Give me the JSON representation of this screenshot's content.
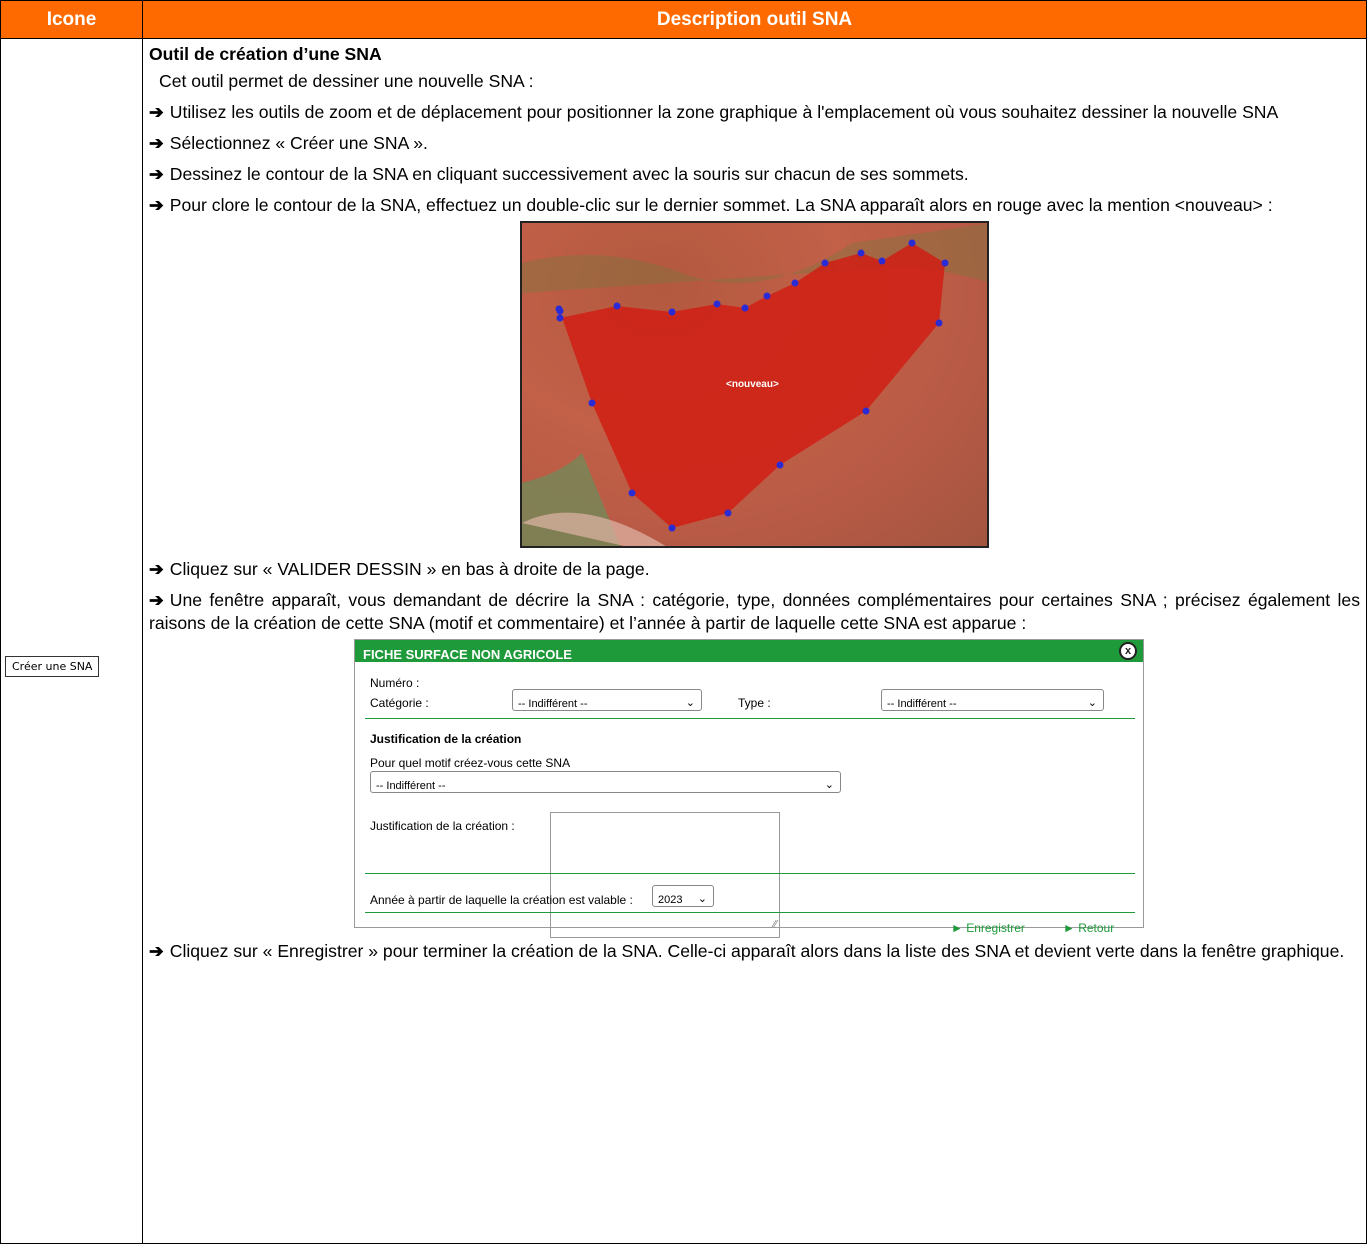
{
  "header": {
    "icon_col": "Icone",
    "desc_col": "Description outil SNA"
  },
  "icon_button": {
    "label": "Créer une SNA"
  },
  "section": {
    "title": "Outil de création d’une SNA",
    "intro": "Cet outil permet de dessiner une nouvelle SNA :",
    "steps": [
      "Utilisez les outils de zoom et de déplacement pour positionner la zone graphique à l'emplacement où vous souhaitez dessiner la nouvelle SNA",
      "Sélectionnez « Créer une SNA ».",
      "Dessinez le contour de la SNA en cliquant successivement avec la souris sur chacun de ses sommets.",
      "Pour clore le contour de la SNA, effectuez un double-clic sur le dernier sommet. La SNA apparaît alors en rouge avec la mention <nouveau> :"
    ],
    "steps_after_map": [
      "Cliquez sur « VALIDER DESSIN » en bas à droite de la page.",
      "Une fenêtre apparaît, vous demandant de décrire la SNA : catégorie, type, données complémentaires pour certaines SNA ; précisez également les raisons de la création de cette SNA (motif et commentaire) et l’année à partir de laquelle cette SNA est apparue :"
    ],
    "final_step": "Cliquez sur « Enregistrer » pour terminer la création de la SNA. Celle-ci apparaît alors dans la liste des SNA et devient verte dans la fenêtre graphique.",
    "arrow": "➔"
  },
  "map": {
    "polygon_label": "<nouveau>",
    "polygon_color": "#d01e14",
    "vertex_color": "#2b2bd6"
  },
  "form": {
    "title": "FICHE SURFACE NON AGRICOLE",
    "close": "x",
    "numero_label": "Numéro :",
    "categorie_label": "Catégorie :",
    "categorie_value": "-- Indifférent --",
    "type_label": "Type :",
    "type_value": "-- Indifférent --",
    "justif_heading": "Justification de la création",
    "motif_label": "Pour quel motif créez-vous cette SNA",
    "motif_value": "-- Indifférent --",
    "justif_label": "Justification de la création :",
    "annee_label": "Année à partir de laquelle la création est valable :",
    "annee_value": "2023",
    "save_label": "► Enregistrer",
    "back_label": "► Retour",
    "accent": "#1f9a3a"
  }
}
